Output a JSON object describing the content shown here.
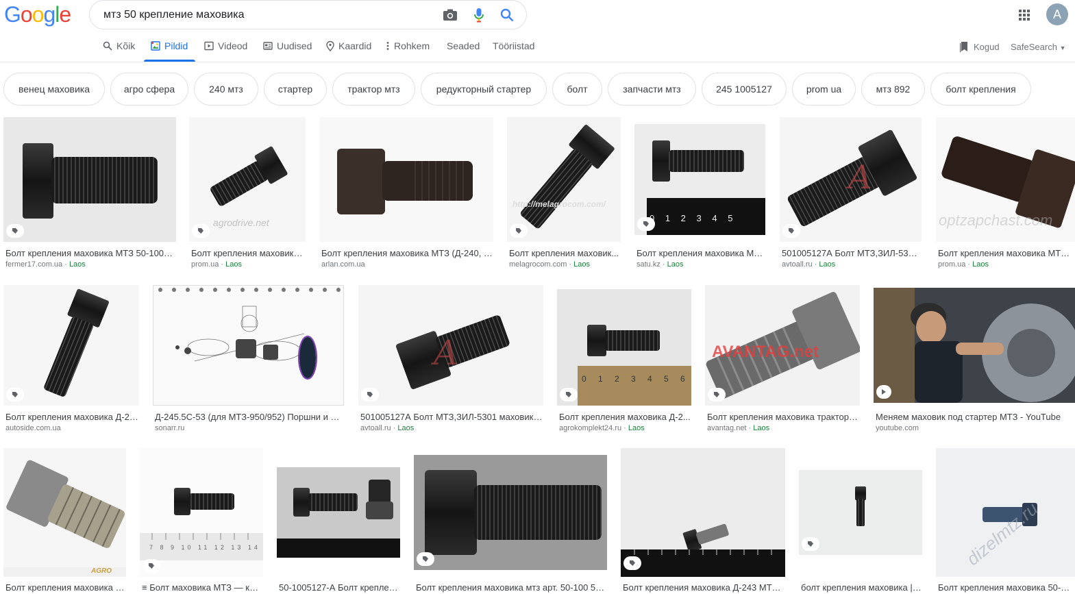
{
  "logo": {
    "text": "Google"
  },
  "search": {
    "query": "мтз 50 крепление маховика",
    "camera_icon": "camera-icon",
    "mic_icon": "mic-icon",
    "search_icon": "search-icon"
  },
  "header": {
    "avatar_letter": "A",
    "apps_icon": "apps-grid-icon"
  },
  "tabs": [
    {
      "label": "Kõik",
      "icon": "search-icon"
    },
    {
      "label": "Pildid",
      "icon": "image-icon",
      "active": true
    },
    {
      "label": "Videod",
      "icon": "play-icon"
    },
    {
      "label": "Uudised",
      "icon": "news-icon"
    },
    {
      "label": "Kaardid",
      "icon": "map-pin-icon"
    },
    {
      "label": "Rohkem",
      "icon": "more-vert-icon"
    },
    {
      "label": "Seaded"
    },
    {
      "label": "Tööriistad"
    }
  ],
  "toolbar": {
    "kogud": "Kogud",
    "safesearch": "SafeSearch"
  },
  "chips": [
    "венец маховика",
    "агро сфера",
    "240 мтз",
    "стартер",
    "трактор мтз",
    "редукторный стартер",
    "болт",
    "запчасти мтз",
    "245 1005127",
    "prom ua",
    "мтз 892",
    "болт крепления"
  ],
  "results": [
    {
      "caption": "Болт крепления маховика МТЗ 50-1005...",
      "source": "fermer17.com.ua",
      "loc": "Laos"
    },
    {
      "caption": "Болт крепления маховика...",
      "source": "prom.ua",
      "loc": "Laos"
    },
    {
      "caption": "Болт крепления маховика МТЗ (Д-240, Д...",
      "source": "arlan.com.ua",
      "loc": ""
    },
    {
      "caption": "Болт крепления маховик...",
      "source": "melagrocom.com",
      "loc": "Laos"
    },
    {
      "caption": "Болт крепления маховика МТ...",
      "source": "satu.kz",
      "loc": "Laos"
    },
    {
      "caption": "501005127А Болт МТЗ,ЗИЛ-5301 ...",
      "source": "avtoall.ru",
      "loc": "Laos"
    },
    {
      "caption": "Болт крепления маховика МТЗ ...",
      "source": "prom.ua",
      "loc": "Laos"
    },
    {
      "caption": "Болт крепления маховика Д-24...",
      "source": "autoside.com.ua",
      "loc": ""
    },
    {
      "caption": "Д-245.5С-53 (для МТЗ-950/952) Поршни и ша...",
      "source": "sonarr.ru",
      "loc": ""
    },
    {
      "caption": "501005127А Болт МТЗ,ЗИЛ-5301 маховика ...",
      "source": "avtoall.ru",
      "loc": "Laos"
    },
    {
      "caption": "Болт крепления маховика Д-2...",
      "source": "agrokomplekt24.ru",
      "loc": "Laos"
    },
    {
      "caption": "Болт крепления маховика трактора...",
      "source": "avantag.net",
      "loc": "Laos"
    },
    {
      "caption": "Меняем маховик под стартер МТЗ - YouTube",
      "source": "youtube.com",
      "loc": ""
    },
    {
      "caption": "Болт крепления маховика 5...",
      "source": "",
      "loc": ""
    },
    {
      "caption": "≡ Болт маховика МТЗ — куп...",
      "source": "",
      "loc": ""
    },
    {
      "caption": "50-1005127-А Болт креплен...",
      "source": "",
      "loc": ""
    },
    {
      "caption": "Болт крепления маховика мтз арт. 50-100 51...",
      "source": "",
      "loc": ""
    },
    {
      "caption": "Болт крепления маховика Д-243 МТЗ-...",
      "source": "",
      "loc": ""
    },
    {
      "caption": "болт крепления маховика | ...",
      "source": "",
      "loc": ""
    },
    {
      "caption": "Болт крепления маховика 50-10...",
      "source": "",
      "loc": ""
    }
  ],
  "watermarks": [
    "agrodrive.net",
    "http://melagrocom.com/",
    "A",
    "optzapchast.com",
    "A",
    "AVANTAG.net",
    "AGRO",
    "dizelmtz.ru"
  ],
  "ruler_labels": [
    "0 1 2 3 4 5",
    "0 1 2 3 4 5 6",
    "7 8 9 10 11 12 13 14 15"
  ],
  "colors": {
    "accent": "#1a73e8",
    "source_location": "#188038",
    "logo_blue": "#4285f4",
    "logo_red": "#ea4335",
    "logo_yellow": "#fbbc05",
    "logo_green": "#34a853"
  }
}
